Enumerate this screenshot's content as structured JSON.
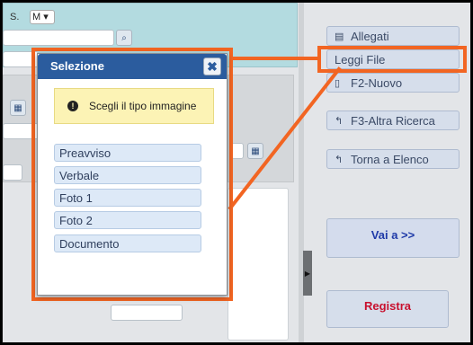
{
  "background": {
    "top_label": "S.",
    "select_value": "M"
  },
  "dialog": {
    "title": "Selezione",
    "message": "Scegli il tipo immagine",
    "options": [
      "Preavviso",
      "Verbale",
      "Foto 1",
      "Foto 2",
      "Documento"
    ]
  },
  "sidebar": {
    "allegati": "Allegati",
    "leggi_file": "Leggi File",
    "nuovo": "F2-Nuovo",
    "altra_ricerca": "F3-Altra Ricerca",
    "torna_elenco": "Torna a Elenco",
    "vai_a": "Vai a >>",
    "registra": "Registra"
  },
  "colors": {
    "highlight": "#f26522",
    "title_bar": "#2b5c9e",
    "registra": "#c8102e"
  }
}
